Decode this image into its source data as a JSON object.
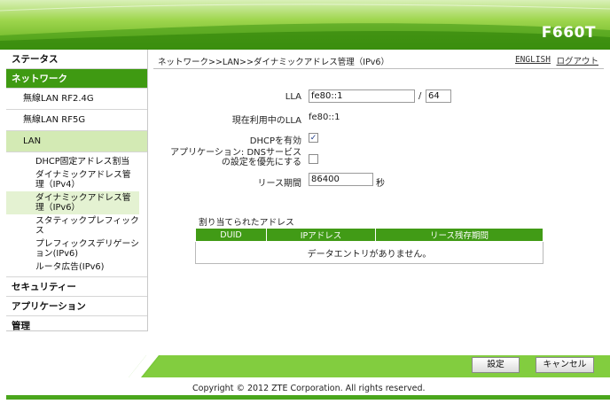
{
  "header": {
    "model": "F660T"
  },
  "colors": {
    "brand_green": "#419b16",
    "active_nav": "#3f9a12",
    "sub_active": "#d3eab4"
  },
  "sidebar": {
    "status": "ステータス",
    "network": "ネットワーク",
    "wlan24": "無線LAN RF2.4G",
    "wlan5": "無線LAN RF5G",
    "lan": "LAN",
    "lan_items": [
      "DHCP固定アドレス割当",
      "ダイナミックアドレス管理（IPv4）",
      "ダイナミックアドレス管理（IPv6）",
      "スタティックプレフィックス",
      "プレフィックスデリゲーション(IPv6)",
      "ルータ広告(IPv6)"
    ],
    "security": "セキュリティー",
    "application": "アプリケーション",
    "admin": "管理"
  },
  "topbar": {
    "breadcrumb": "ネットワーク>>LAN>>ダイナミックアドレス管理（IPv6）",
    "english": "ENGLISH",
    "logout": "ログアウト"
  },
  "form": {
    "lla_label": "LLA",
    "lla_value": "fe80::1",
    "lla_sep": "/",
    "lla_prefix": "64",
    "current_lla_label": "現在利用中のLLA",
    "current_lla_value": "fe80::1",
    "dhcp_label": "DHCPを有効",
    "dhcp_checked": true,
    "dhcp_check_glyph": "✓",
    "dns_label_line1": "アプリケーション: DNSサービス",
    "dns_label_line2": "の設定を優先にする",
    "dns_checked": false,
    "lease_label": "リース期間",
    "lease_value": "86400",
    "lease_unit": "秒"
  },
  "table": {
    "title": "割り当てられたアドレス",
    "columns": [
      "DUID",
      "IPアドレス",
      "リース残存期間"
    ],
    "empty_text": "データエントリがありません。"
  },
  "buttons": {
    "save": "設定",
    "cancel": "キャンセル"
  },
  "footer": {
    "copyright": "Copyright © 2012 ZTE Corporation. All rights reserved."
  }
}
